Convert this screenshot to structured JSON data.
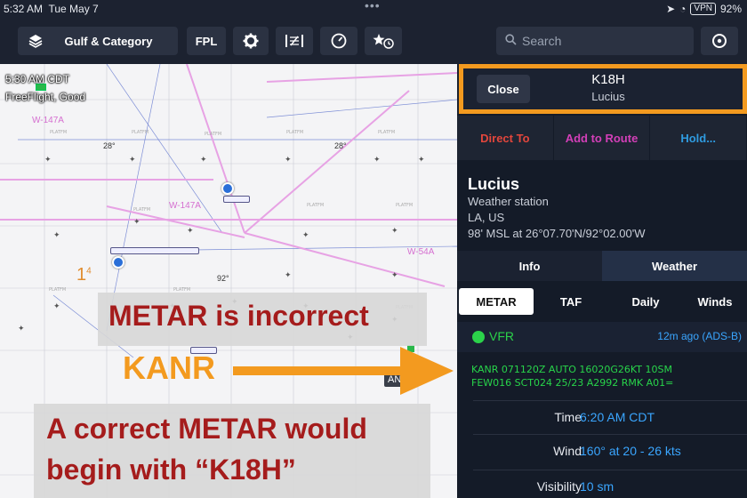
{
  "status_bar": {
    "time": "5:32 AM",
    "date": "Tue May 7",
    "vpn": "VPN",
    "battery": "92%"
  },
  "toolbar": {
    "layers_label": "Gulf & Category",
    "fpl_label": "FPL",
    "search_placeholder": "Search"
  },
  "map": {
    "time_overlay": "5:30 AM CDT",
    "flight_status": "FreeFlight, Good",
    "airways": [
      "W-147A",
      "W-147A",
      "W-54A"
    ],
    "altitudes": [
      "28°",
      "28°",
      "92°"
    ],
    "beacon_label": "ANG",
    "unknown_label": "1",
    "unknown_sup": "4"
  },
  "annotations": {
    "note1": "METAR is incorrect",
    "kanr": "KANR",
    "note2_line1": "A correct METAR would",
    "note2_line2": "begin with “K18H”"
  },
  "panel": {
    "close_label": "Close",
    "station_id": "K18H",
    "station_subtitle": "Lucius",
    "actions": {
      "direct_to": "Direct To",
      "add_to_route": "Add to Route",
      "hold": "Hold..."
    },
    "station_name": "Lucius",
    "station_type": "Weather station",
    "location": "LA, US",
    "elevation_coords": "98' MSL at 26°07.70'N/92°02.00'W",
    "tabs": {
      "info": "Info",
      "weather": "Weather"
    },
    "wx_tabs": {
      "metar": "METAR",
      "taf": "TAF",
      "daily": "Daily",
      "winds": "Winds"
    },
    "flight_category": "VFR",
    "age": "12m ago (ADS-B)",
    "metar_line1": "KANR 071120Z AUTO 16020G26KT 10SM",
    "metar_line2": "FEW016 SCT024 25/23 A2992 RMK A01=",
    "rows": [
      {
        "label": "Time",
        "value": "6:20 AM CDT"
      },
      {
        "label": "Wind",
        "value": "160° at 20 - 26 kts"
      },
      {
        "label": "Visibility",
        "value": "10 sm"
      }
    ]
  },
  "colors": {
    "annotation_red": "#a51c1c",
    "annotation_orange": "#f39a1f",
    "vfr_green": "#2bd24a",
    "link_blue": "#3aa6ff",
    "direct_to_red": "#e2463c",
    "route_magenta": "#d33fb8"
  }
}
